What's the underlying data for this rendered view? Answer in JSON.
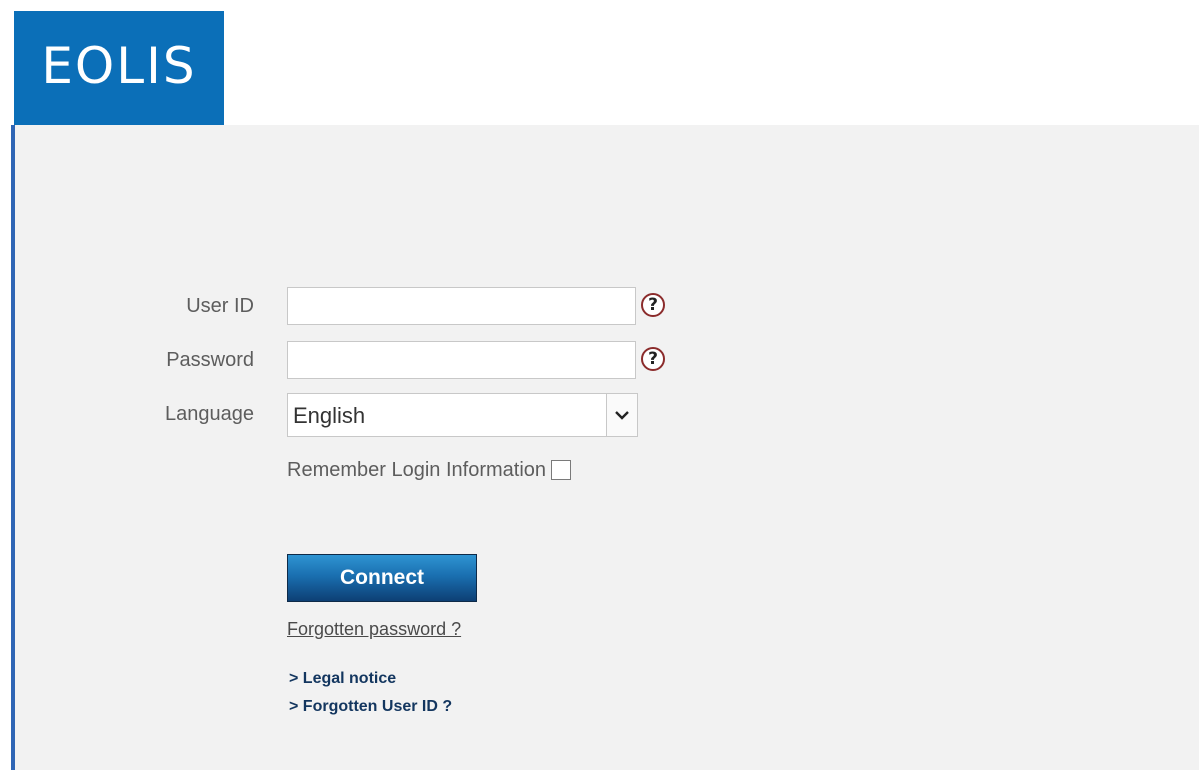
{
  "logo": {
    "text": "EOLIS"
  },
  "form": {
    "user_id": {
      "label": "User ID",
      "value": "",
      "placeholder": ""
    },
    "password": {
      "label": "Password",
      "value": "",
      "placeholder": ""
    },
    "language": {
      "label": "Language",
      "selected": "English"
    },
    "remember": {
      "label": "Remember Login Information",
      "checked": false
    },
    "help_glyph": "?"
  },
  "actions": {
    "connect_label": "Connect",
    "forgotten_password": "Forgotten password ?"
  },
  "links": {
    "legal_notice": "> Legal notice",
    "forgotten_user_id": "> Forgotten User ID ?"
  },
  "colors": {
    "brand_blue": "#0b6fb8",
    "panel_bg": "#f2f2f2",
    "panel_border": "#2f66b5",
    "button_top": "#2f94d2",
    "button_bottom": "#0d3f74",
    "link_color": "#13365f",
    "help_ring": "#8b2b2b"
  }
}
